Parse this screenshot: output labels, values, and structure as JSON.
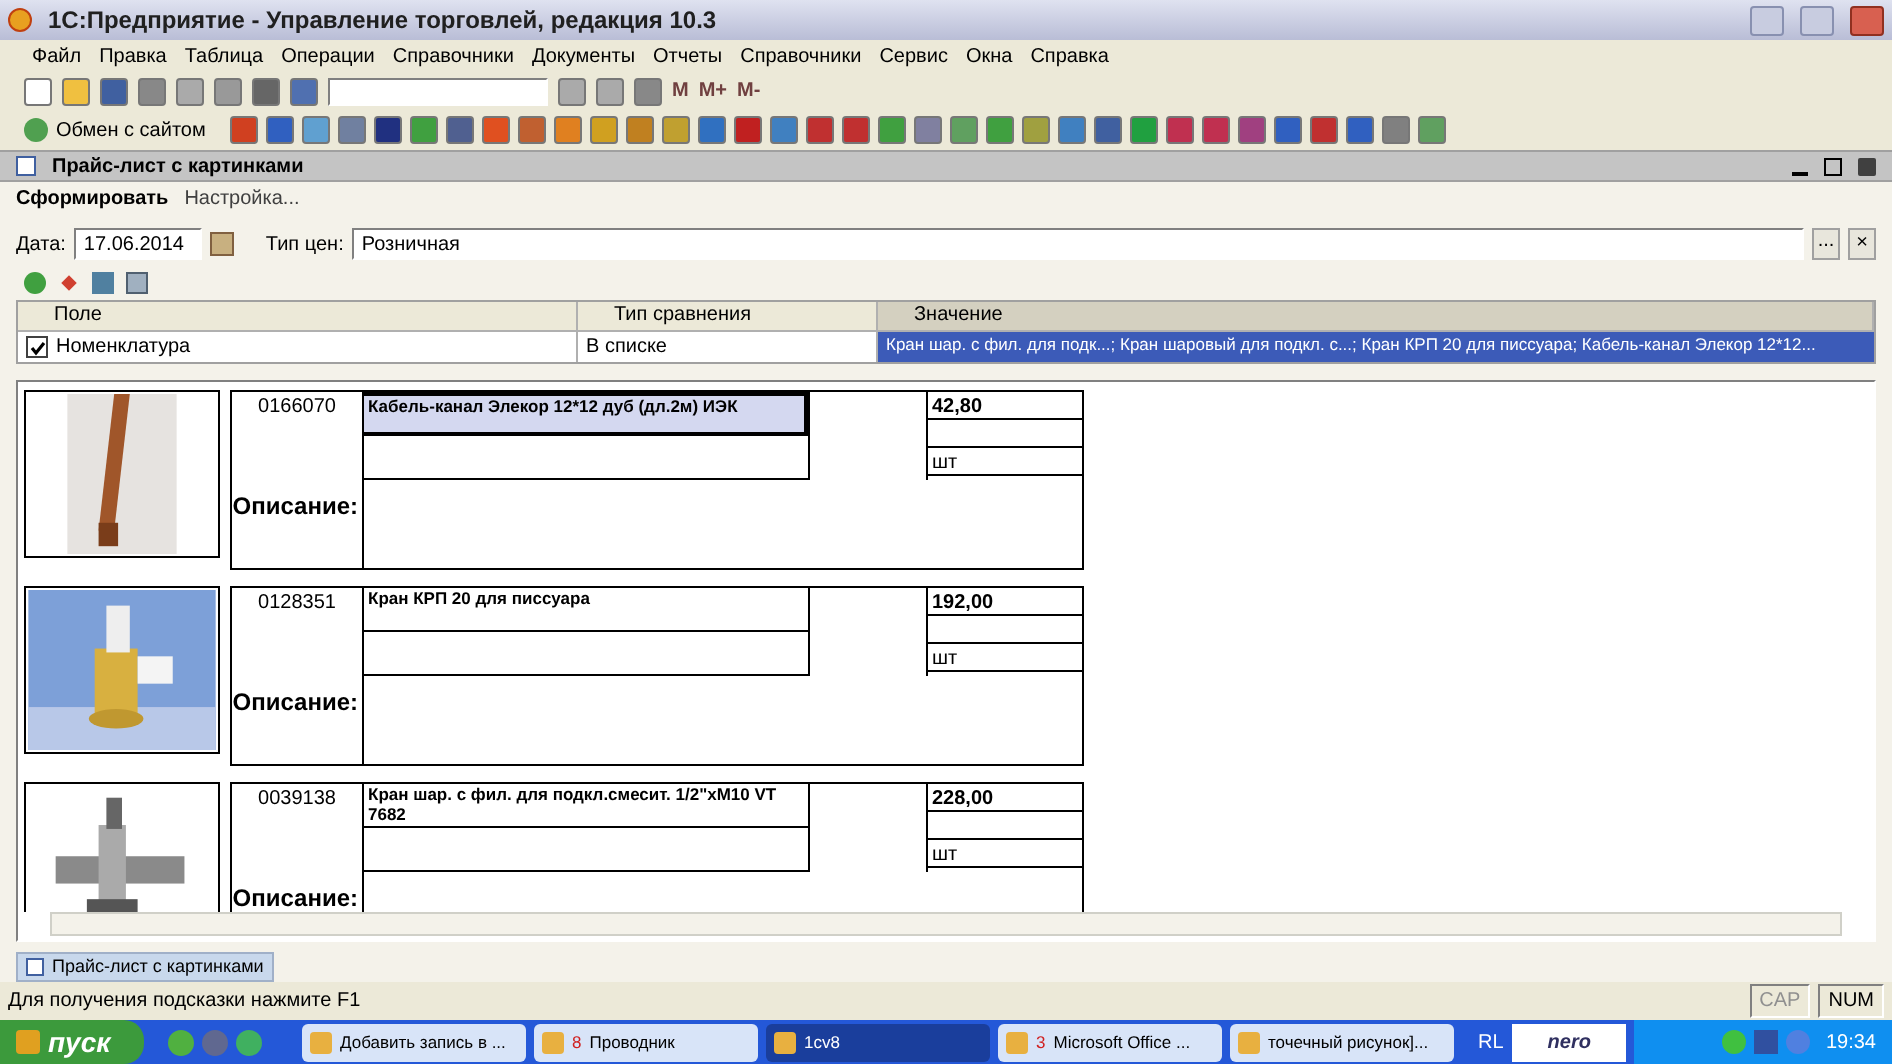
{
  "window": {
    "title": "1С:Предприятие - Управление торговлей, редакция 10.3"
  },
  "menu": [
    "Файл",
    "Правка",
    "Таблица",
    "Операции",
    "Справочники",
    "Документы",
    "Отчеты",
    "Справочники",
    "Сервис",
    "Окна",
    "Справка"
  ],
  "toolbar": {
    "memory_buttons": [
      "M",
      "M+",
      "M-"
    ],
    "exchange_button": "Обмен с сайтом"
  },
  "document": {
    "title": "Прайс-лист с картинками",
    "commands": [
      "Сформировать",
      "Настройка..."
    ],
    "date_label": "Дата:",
    "date": "17.06.2014",
    "price_type_label": "Тип цен:",
    "price_type": "Розничная",
    "choose_button": "...",
    "clear_button": "×",
    "filter": {
      "columns": [
        "Поле",
        "Тип сравнения",
        "Значение"
      ],
      "rows": [
        {
          "checked": true,
          "selected": true,
          "field": "Номенклатура",
          "comparison": "В списке",
          "value": "Кран шар. с фил. для подк...; Кран шаровый для подкл. с...; Кран КРП 20 для писсуара; Кабель-канал Элекор 12*12..."
        }
      ]
    },
    "products": [
      {
        "code": "0166070",
        "name": "Кабель-канал Элекор 12*12 дуб (дл.2м) ИЭК",
        "price": "42,80",
        "unit": "шт",
        "description_label": "Описание:",
        "selected": true
      },
      {
        "code": "0128351",
        "name": "Кран КРП 20 для писсуара",
        "price": "192,00",
        "unit": "шт",
        "description_label": "Описание:",
        "selected": false
      },
      {
        "code": "0039138",
        "name": "Кран шар. с фил. для подкл.смесит. 1/2\"хМ10 VT 7682",
        "price": "228,00",
        "unit": "шт",
        "description_label": "Описание:",
        "selected": false
      }
    ]
  },
  "window_tabs": [
    {
      "label": "Прайс-лист с картинками",
      "selected": true
    }
  ],
  "status_bar": {
    "hint": "Для получения подсказки нажмите F1",
    "indicators": [
      "CAP",
      "NUM"
    ]
  },
  "taskbar": {
    "start": "пуск",
    "tasks": [
      {
        "label": "Добавить запись в ...",
        "selected": false
      },
      {
        "label": "Проводник",
        "count": "8",
        "selected": false
      },
      {
        "label": "1cv8",
        "selected": true
      },
      {
        "label": "Microsoft Office ...",
        "count": "3",
        "selected": false
      },
      {
        "label": "точечный рисунок]...",
        "selected": false
      }
    ],
    "language": "RL",
    "search_logo": "nero",
    "time": "19:34"
  }
}
